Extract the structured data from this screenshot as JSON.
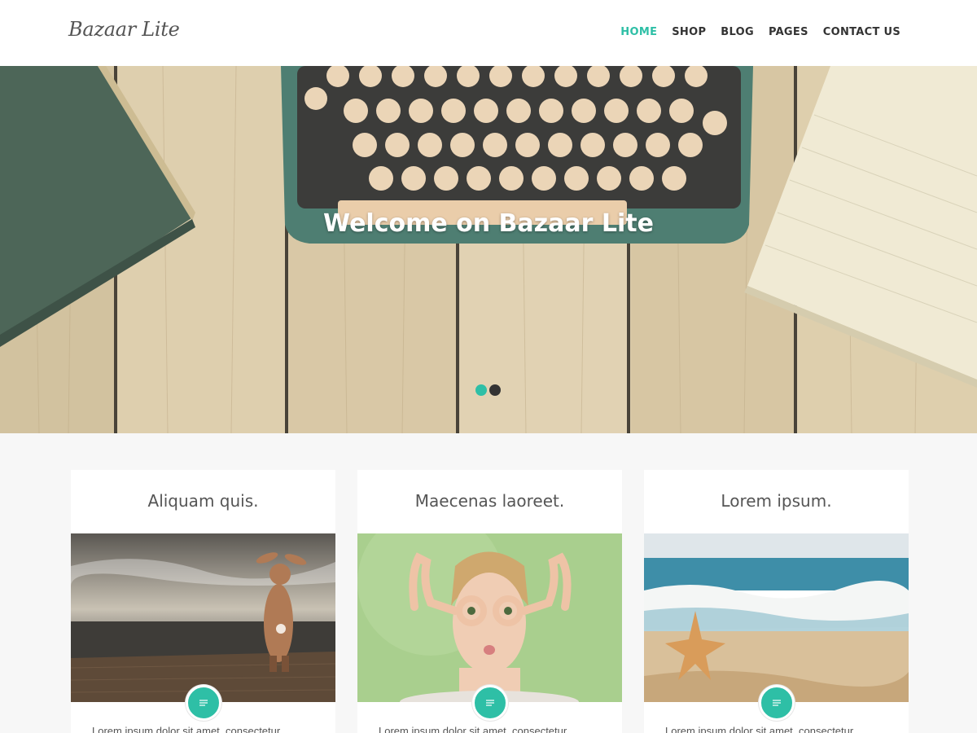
{
  "site": {
    "logo": "Bazaar Lite",
    "nav": [
      "HOME",
      "SHOP",
      "BLOG",
      "PAGES",
      "CONTACT US"
    ],
    "active_nav": "HOME"
  },
  "hero": {
    "title": "Welcome on Bazaar Lite",
    "slides_count": 2,
    "active_slide": 1
  },
  "cards": [
    {
      "title": "Aliquam quis.",
      "excerpt": "Lorem ipsum dolor sit amet, consectetur",
      "icon": "post-format-icon"
    },
    {
      "title": "Maecenas laoreet.",
      "excerpt": "Lorem ipsum dolor sit amet, consectetur",
      "icon": "post-format-icon"
    },
    {
      "title": "Lorem ipsum.",
      "excerpt": "Lorem ipsum dolor sit amet, consectetur",
      "icon": "post-format-icon"
    }
  ],
  "colors": {
    "accent": "#2ebfa6",
    "nav_text": "#333333",
    "page_bg": "#f7f7f7"
  }
}
